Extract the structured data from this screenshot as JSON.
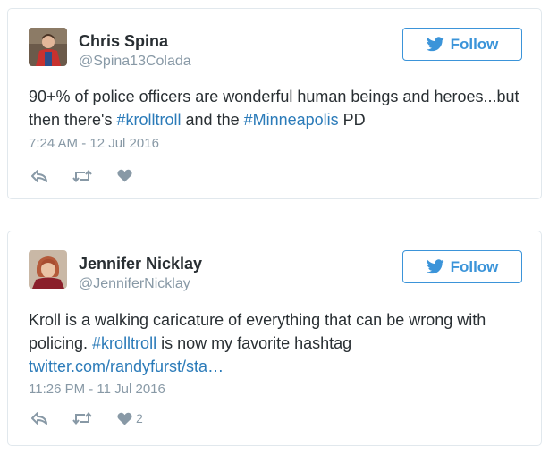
{
  "tweets": [
    {
      "author_name": "Chris Spina",
      "handle": "@Spina13Colada",
      "follow_label": "Follow",
      "text": {
        "part1": "90+% of police officers are wonderful human beings and heroes...but then there's ",
        "hashtag1": "#krolltroll",
        "part2": " and the ",
        "hashtag2": "#Minneapolis",
        "part3": " PD"
      },
      "timestamp": "7:24 AM - 12 Jul 2016",
      "like_count": ""
    },
    {
      "author_name": "Jennifer Nicklay",
      "handle": "@JenniferNicklay",
      "follow_label": "Follow",
      "text": {
        "part1": "Kroll is a walking caricature of everything that can be wrong with policing. ",
        "hashtag1": "#krolltroll",
        "part2": " is now my favorite hashtag",
        "link": "twitter.com/randyfurst/sta…"
      },
      "timestamp": "11:26 PM - 11 Jul 2016",
      "like_count": "2"
    }
  ],
  "colors": {
    "link": "#2b7bb9",
    "follow": "#3b94d9",
    "muted": "#8899a6",
    "border": "#e1e8ed"
  },
  "icons": [
    "twitter-bird-icon",
    "reply-icon",
    "retweet-icon",
    "heart-icon"
  ]
}
